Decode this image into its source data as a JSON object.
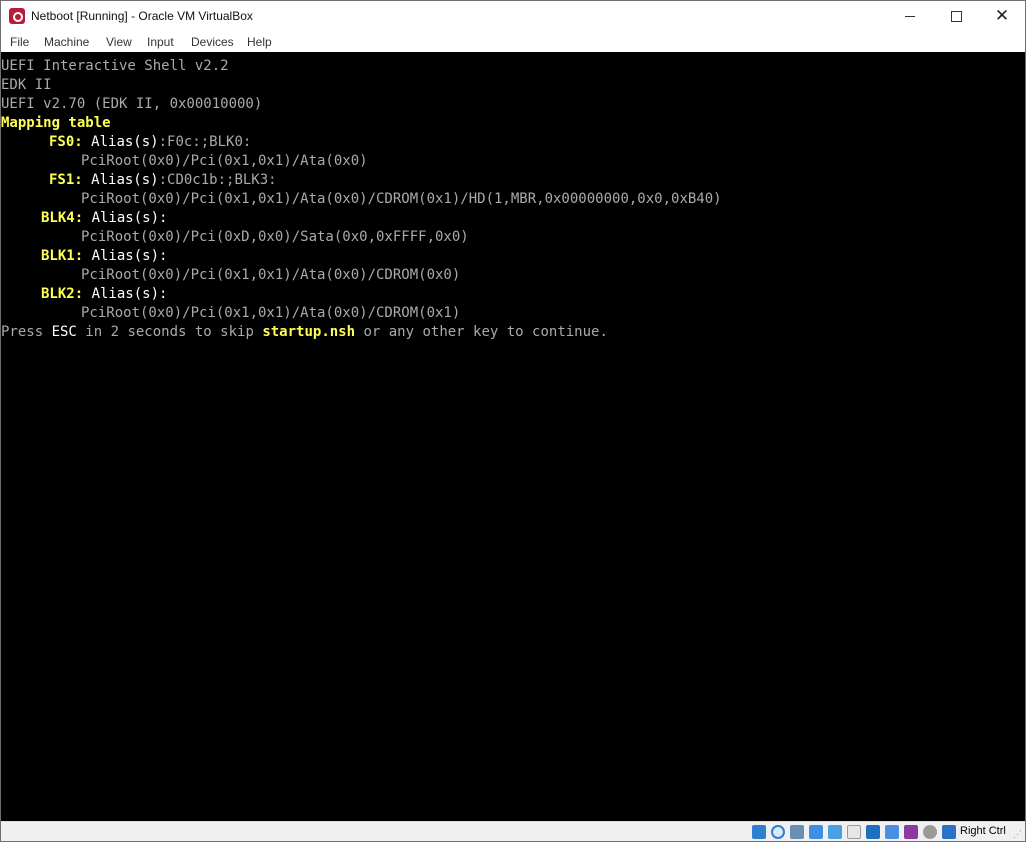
{
  "window": {
    "title": "Netboot [Running] - Oracle VM VirtualBox",
    "app_icon": "virtualbox-icon",
    "controls": {
      "minimize": "minimize-icon",
      "maximize": "maximize-icon",
      "close": "✕"
    }
  },
  "menubar": {
    "items": [
      {
        "label": "File"
      },
      {
        "label": "Machine"
      },
      {
        "label": "View"
      },
      {
        "label": "Input"
      },
      {
        "label": "Devices"
      },
      {
        "label": "Help"
      }
    ]
  },
  "console": {
    "colors": {
      "background": "#000000",
      "gray": "#aaaaaa",
      "white": "#ffffff",
      "yellow": "#ffff55"
    },
    "header": {
      "line1": "UEFI Interactive Shell v2.2",
      "line2": "EDK II",
      "line3": "UEFI v2.70 (EDK II, 0x00010000)",
      "mapping_title": "Mapping table"
    },
    "mappings": [
      {
        "name": "FS0",
        "alias_label": "Alias(s)",
        "aliases": ":F0c:;BLK0:",
        "path": "PciRoot(0x0)/Pci(0x1,0x1)/Ata(0x0)"
      },
      {
        "name": "FS1",
        "alias_label": "Alias(s)",
        "aliases": ":CD0c1b:;BLK3:",
        "path": "PciRoot(0x0)/Pci(0x1,0x1)/Ata(0x0)/CDROM(0x1)/HD(1,MBR,0x00000000,0x0,0xB40)"
      },
      {
        "name": "BLK4",
        "alias_label": "Alias(s)",
        "aliases": ":",
        "path": "PciRoot(0x0)/Pci(0xD,0x0)/Sata(0x0,0xFFFF,0x0)"
      },
      {
        "name": "BLK1",
        "alias_label": "Alias(s)",
        "aliases": ":",
        "path": "PciRoot(0x0)/Pci(0x1,0x1)/Ata(0x0)/CDROM(0x0)"
      },
      {
        "name": "BLK2",
        "alias_label": "Alias(s)",
        "aliases": ":",
        "path": "PciRoot(0x0)/Pci(0x1,0x1)/Ata(0x0)/CDROM(0x1)"
      }
    ],
    "prompt": {
      "press": "Press ",
      "esc": "ESC",
      "middle": " in 2 seconds to skip ",
      "file": "startup.nsh",
      "end": " or any other key to continue."
    }
  },
  "statusbar": {
    "icons": [
      "hard-disk-icon",
      "optical-drive-icon",
      "audio-icon",
      "network-icon",
      "usb-icon",
      "shared-folders-icon",
      "display-icon",
      "recording-icon",
      "cpu-virtualization-icon",
      "mouse-integration-icon",
      "keyboard-capture-icon"
    ],
    "host_key": "Right Ctrl"
  }
}
